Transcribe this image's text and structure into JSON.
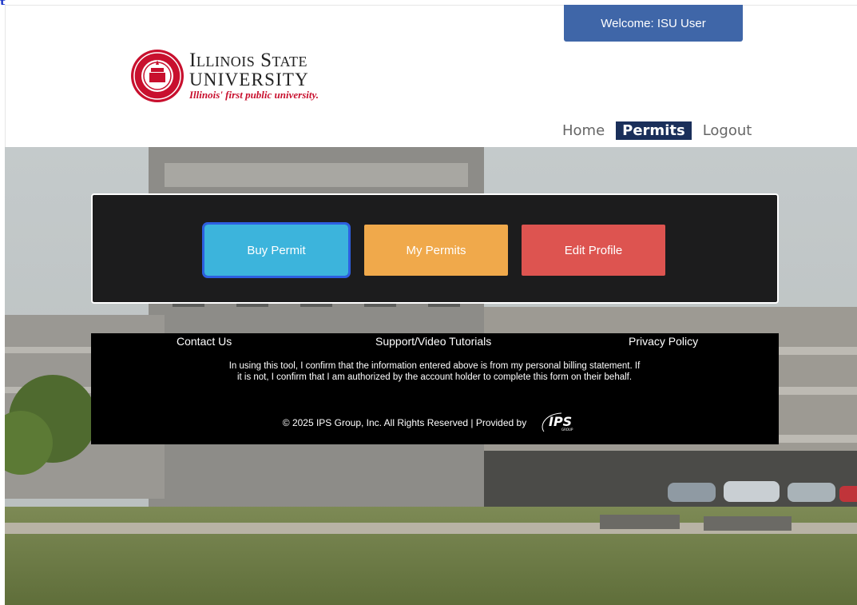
{
  "header": {
    "welcome_text": "Welcome:  ISU User",
    "logo": {
      "line1_cap1": "I",
      "line1_small1": "LLINOIS",
      "line1_cap2": "S",
      "line1_small2": "TATE",
      "line2": "UNIVERSITY",
      "tagline": "Illinois' first public university."
    }
  },
  "nav": {
    "items": [
      {
        "label": "Home"
      },
      {
        "label": "Permits"
      },
      {
        "label": "Logout"
      }
    ]
  },
  "panel": {
    "buttons": [
      {
        "label": "Buy Permit",
        "color": "#3cb4dc"
      },
      {
        "label": "My Permits",
        "color": "#f0a94b"
      },
      {
        "label": "Edit Profile",
        "color": "#dd5450"
      }
    ]
  },
  "footer": {
    "links": [
      "Contact Us",
      "Support/Video Tutorials",
      "Privacy Policy"
    ],
    "disclaimer": "In using this tool, I confirm that the information entered above is from my personal billing statement. If it is not, I confirm that I am authorized by the account holder to complete this form on their behalf.",
    "copyright": "© 2025 IPS Group, Inc. All Rights Reserved  | Provided by"
  },
  "colors": {
    "welcome_bg": "#3f66a8",
    "nav_active_bg": "#1a2f5a",
    "brand_red": "#c8102e"
  }
}
